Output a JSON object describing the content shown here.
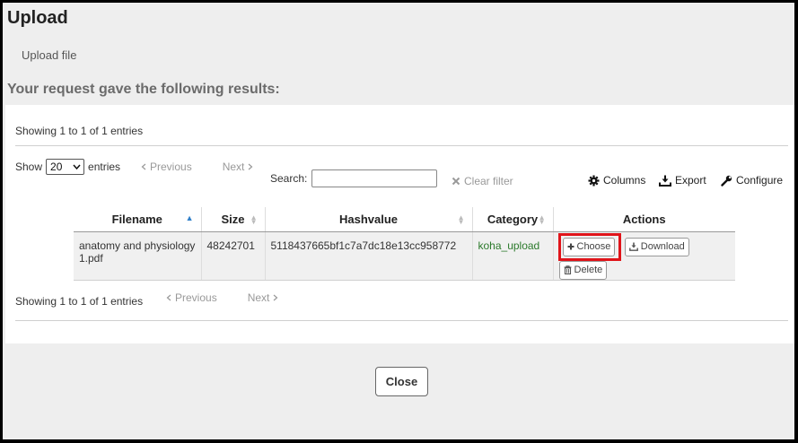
{
  "header": {
    "title": "Upload",
    "upload_link": "Upload file",
    "results_heading": "Your request gave the following results:"
  },
  "table_info": {
    "top": "Showing 1 to 1 of 1 entries",
    "bottom": "Showing 1 to 1 of 1 entries"
  },
  "length_menu": {
    "show_label": "Show",
    "selected": "20",
    "entries_label": "entries"
  },
  "pagination": {
    "previous": "Previous",
    "next": "Next"
  },
  "search": {
    "label": "Search:",
    "value": "",
    "clear_filter": "Clear filter"
  },
  "toolbar": {
    "columns": "Columns",
    "export": "Export",
    "configure": "Configure"
  },
  "columns": [
    "Filename",
    "Size",
    "Hashvalue",
    "Category",
    "Actions"
  ],
  "rows": [
    {
      "filename": "anatomy and physiology 1.pdf",
      "size": "48242701",
      "hashvalue": "5118437665bf1c7a7dc18e13cc958772",
      "category": "koha_upload"
    }
  ],
  "actions": {
    "choose": "Choose",
    "download": "Download",
    "delete": "Delete"
  },
  "footer": {
    "close": "Close"
  },
  "colors": {
    "highlight": "#e0141a",
    "category_link": "#2c7a2c",
    "sort_active": "#2f7fc9"
  },
  "icons": [
    "chevron-left-icon",
    "chevron-right-icon",
    "clear-filter-icon",
    "gear-icon",
    "download-icon",
    "wrench-icon",
    "plus-icon",
    "trash-icon",
    "sort-asc-icon",
    "sort-both-icon"
  ]
}
